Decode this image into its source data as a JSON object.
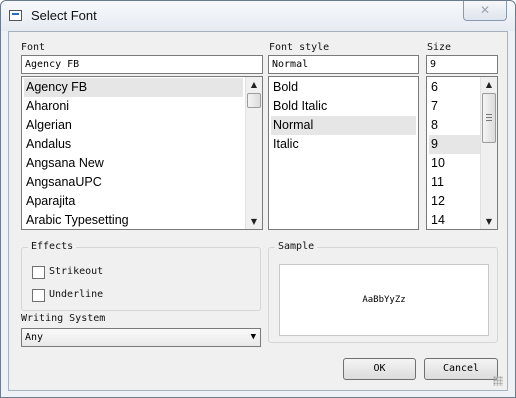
{
  "window": {
    "title": "Select Font",
    "close_glyph": "✕"
  },
  "labels": {
    "font": "Font",
    "style": "Font style",
    "size": "Size"
  },
  "font_input": "Agency FB",
  "style_input": "Normal",
  "size_input": "9",
  "font_list": [
    "Agency FB",
    "Aharoni",
    "Algerian",
    "Andalus",
    "Angsana New",
    "AngsanaUPC",
    "Aparajita",
    "Arabic Typesetting"
  ],
  "style_list": [
    "Bold",
    "Bold Italic",
    "Normal",
    "Italic"
  ],
  "size_list": [
    "6",
    "7",
    "8",
    "9",
    "10",
    "11",
    "12",
    "14"
  ],
  "effects": {
    "title": "Effects",
    "strikeout": "Strikeout",
    "underline": "Underline"
  },
  "writing_system": {
    "label": "Writing System",
    "value": "Any"
  },
  "sample": {
    "title": "Sample",
    "text": "AaBbYyZz"
  },
  "buttons": {
    "ok": "OK",
    "cancel": "Cancel"
  },
  "icons": {
    "title": "window-icon",
    "scroll_up": "▲",
    "scroll_down": "▼",
    "combo": "▼"
  }
}
